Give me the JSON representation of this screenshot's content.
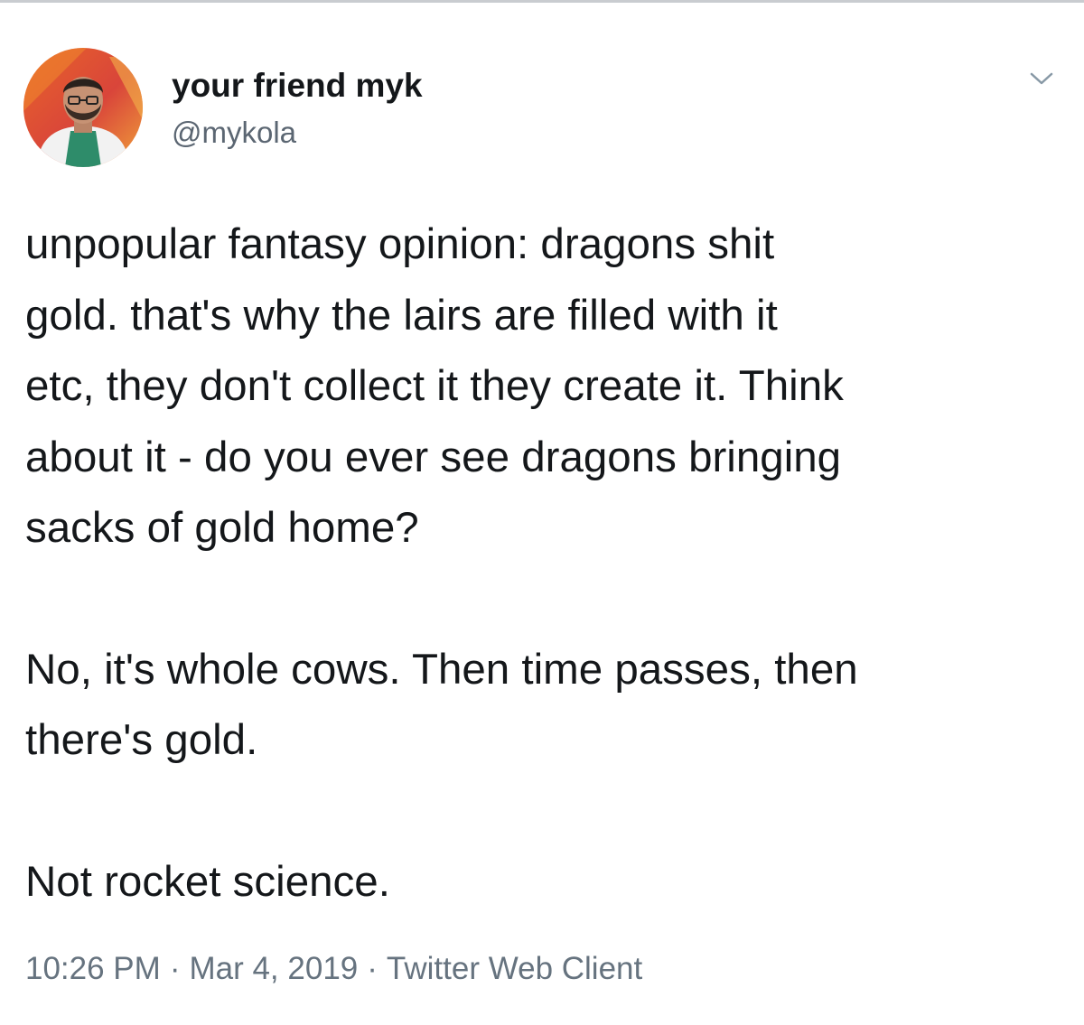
{
  "tweet": {
    "author": {
      "display_name": "your friend myk",
      "handle": "@mykola"
    },
    "caret_icon": "chevron-down-icon",
    "paragraphs": [
      [
        "unpopular fantasy opinion: dragons shit",
        "gold. that's why the lairs are filled with it",
        "etc, they don't collect it they create it. Think",
        "about it - do you ever see dragons bringing",
        "sacks of gold home?"
      ],
      [
        "No, it's whole cows. Then time passes, then",
        "there's gold."
      ],
      [
        "Not rocket science."
      ]
    ],
    "meta": {
      "time": "10:26 PM",
      "date": "Mar 4, 2019",
      "client": "Twitter Web Client",
      "separator": "·"
    }
  },
  "colors": {
    "text": "#14171a",
    "secondary": "#5b6672",
    "meta": "#66737f",
    "rule": "#c9ccd0"
  }
}
